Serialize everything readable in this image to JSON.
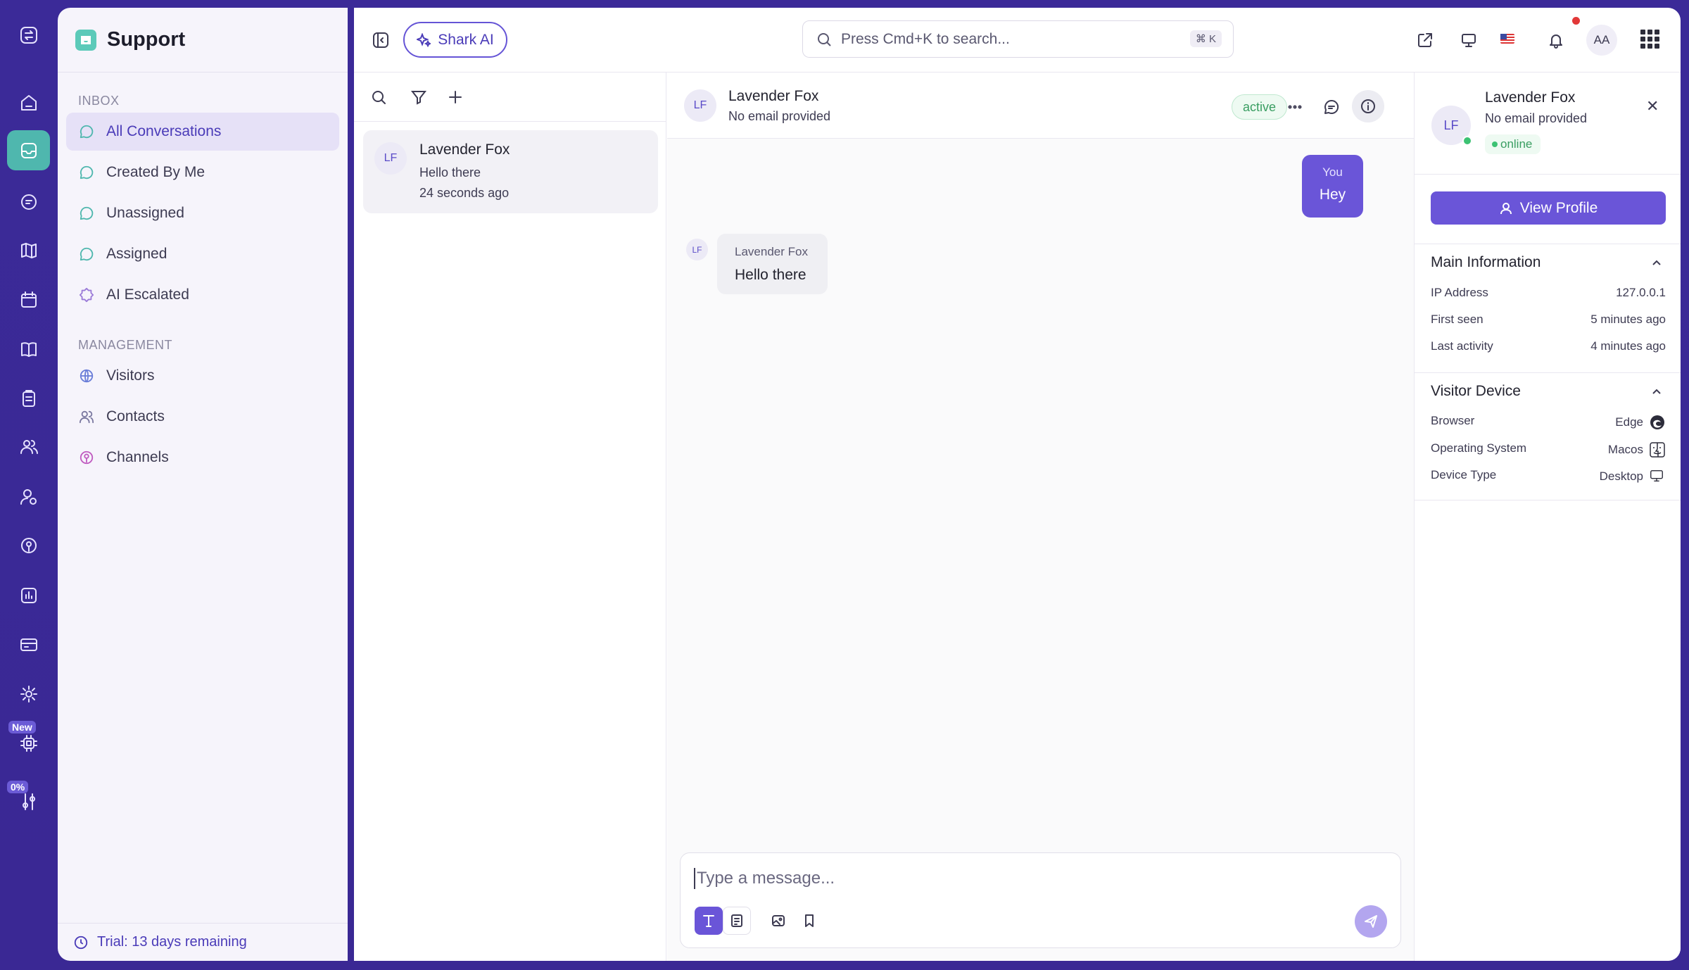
{
  "app": {
    "title": "Support"
  },
  "sidebar": {
    "inbox_label": "INBOX",
    "inbox_items": [
      {
        "label": "All Conversations",
        "icon": "chat-bubble-icon",
        "active": true
      },
      {
        "label": "Created By Me",
        "icon": "chat-bubble-icon"
      },
      {
        "label": "Unassigned",
        "icon": "chat-bubble-icon"
      },
      {
        "label": "Assigned",
        "icon": "chat-bubble-icon"
      },
      {
        "label": "AI Escalated",
        "icon": "badge-alert-icon"
      }
    ],
    "management_label": "MANAGEMENT",
    "management_items": [
      {
        "label": "Visitors",
        "icon": "globe-icon"
      },
      {
        "label": "Contacts",
        "icon": "users-icon"
      },
      {
        "label": "Channels",
        "icon": "radio-icon"
      }
    ],
    "trial": "Trial: 13 days remaining"
  },
  "rail": {
    "new_tag": "New",
    "progress_tag": "0%"
  },
  "topbar": {
    "shark_ai": "Shark AI",
    "search_placeholder": "Press Cmd+K to search...",
    "search_shortcut": "⌘ K",
    "user_initials": "AA"
  },
  "conversations": [
    {
      "initials": "LF",
      "name": "Lavender Fox",
      "last_message": "Hello there",
      "time": "24 seconds ago"
    }
  ],
  "chat": {
    "initials": "LF",
    "name": "Lavender Fox",
    "email": "No email provided",
    "status": "active",
    "messages": [
      {
        "from": "You",
        "text": "Hey",
        "outgoing": true
      },
      {
        "from": "Lavender Fox",
        "initials": "LF",
        "text": "Hello there",
        "outgoing": false
      }
    ],
    "composer_placeholder": "Type a message..."
  },
  "details": {
    "initials": "LF",
    "name": "Lavender Fox",
    "email": "No email provided",
    "presence": "online",
    "view_profile": "View Profile",
    "main_info_title": "Main Information",
    "main_info": [
      {
        "key": "IP Address",
        "value": "127.0.0.1"
      },
      {
        "key": "First seen",
        "value": "5 minutes ago"
      },
      {
        "key": "Last activity",
        "value": "4 minutes ago"
      }
    ],
    "device_title": "Visitor Device",
    "device": [
      {
        "key": "Browser",
        "value": "Edge",
        "icon": "edge-icon"
      },
      {
        "key": "Operating System",
        "value": "Macos",
        "icon": "macos-icon"
      },
      {
        "key": "Device Type",
        "value": "Desktop",
        "icon": "desktop-icon"
      }
    ]
  },
  "colors": {
    "accent": "#6a55d8",
    "rail": "#3b2a98",
    "teal": "#4fb7ae",
    "online": "#3cc273"
  }
}
